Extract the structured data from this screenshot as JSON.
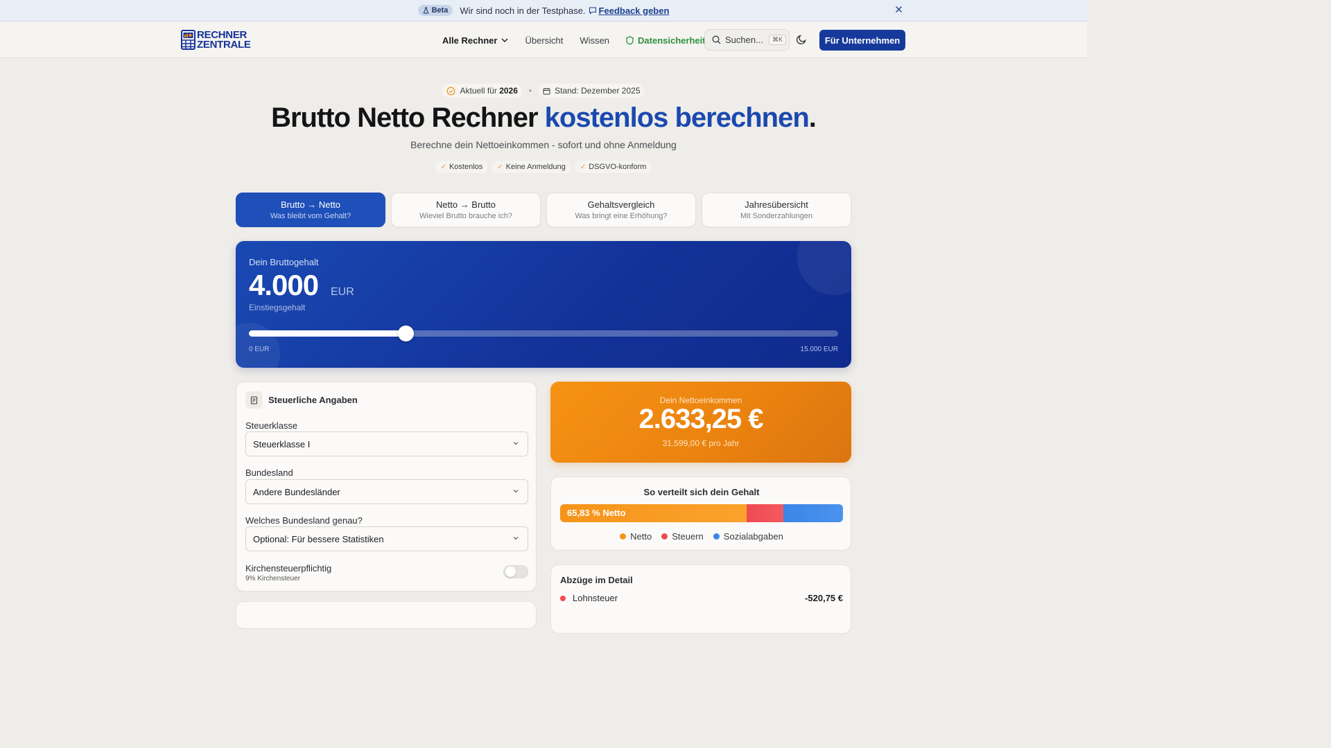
{
  "banner": {
    "beta_label": "Beta",
    "message": "Wir sind noch in der Testphase.",
    "feedback_link": "Feedback geben",
    "close_icon": "close-icon"
  },
  "header": {
    "logo_line1": "RECHNER",
    "logo_line2": "ZENTRALE",
    "nav": {
      "all_calculators": "Alle Rechner",
      "overview": "Übersicht",
      "knowledge": "Wissen",
      "security": "Datensicherheit"
    },
    "search_placeholder": "Suchen...",
    "search_shortcut": "⌘K",
    "cta": "Für Unternehmen"
  },
  "hero": {
    "current_prefix": "Aktuell für",
    "current_year": "2026",
    "stand": "Stand: Dezember 2025",
    "title_main": "Brutto Netto Rechner",
    "title_accent": "kostenlos berechnen",
    "title_end": ".",
    "subtitle": "Berechne dein Nettoeinkommen - sofort und ohne Anmeldung",
    "badges": [
      "Kostenlos",
      "Keine Anmeldung",
      "DSGVO-konform"
    ]
  },
  "tabs": [
    {
      "label": "Brutto → Netto",
      "sub": "Was bleibt vom Gehalt?"
    },
    {
      "label": "Netto → Brutto",
      "sub": "Wieviel Brutto brauche ich?"
    },
    {
      "label": "Gehaltsvergleich",
      "sub": "Was bringt eine Erhöhung?"
    },
    {
      "label": "Jahresübersicht",
      "sub": "Mit Sonderzahlungen"
    }
  ],
  "brutto": {
    "label": "Dein Bruttogehalt",
    "amount": "4.000",
    "currency": "EUR",
    "hint": "Einstiegsgehalt",
    "slider_min": "0 EUR",
    "slider_max": "15.000 EUR",
    "slider_value": 4000,
    "slider_range": [
      0,
      15000
    ],
    "accent_color": "#1a49b3"
  },
  "tax": {
    "title": "Steuerliche Angaben",
    "steuerklasse_label": "Steuerklasse",
    "steuerklasse_value": "Steuerklasse I",
    "bundesland_label": "Bundesland",
    "bundesland_value": "Andere Bundesländer",
    "genau_label": "Welches Bundesland genau?",
    "genau_value": "Optional: Für bessere Statistiken",
    "kirche_label": "Kirchensteuerpflichtig",
    "kirche_sub": "9% Kirchensteuer",
    "kirche_enabled": false
  },
  "netto": {
    "label": "Dein Nettoeinkommen",
    "amount": "2.633,25 €",
    "year": "31.599,00 € pro Jahr",
    "accent_color": "#f69214"
  },
  "distribution": {
    "title": "So verteilt sich dein Gehalt",
    "bar_label": "65,83 % Netto",
    "netto_share": 65.83,
    "steuer_share": 13.02,
    "sozial_share": 21.15,
    "legend": [
      "Netto",
      "Steuern",
      "Sozialabgaben"
    ],
    "colors": {
      "netto": "#f6941a",
      "steuern": "#f04a52",
      "sozial": "#3a86e6"
    }
  },
  "details": {
    "title": "Abzüge im Detail",
    "rows": [
      {
        "label": "Lohnsteuer",
        "value": "-520,75 €"
      }
    ]
  }
}
